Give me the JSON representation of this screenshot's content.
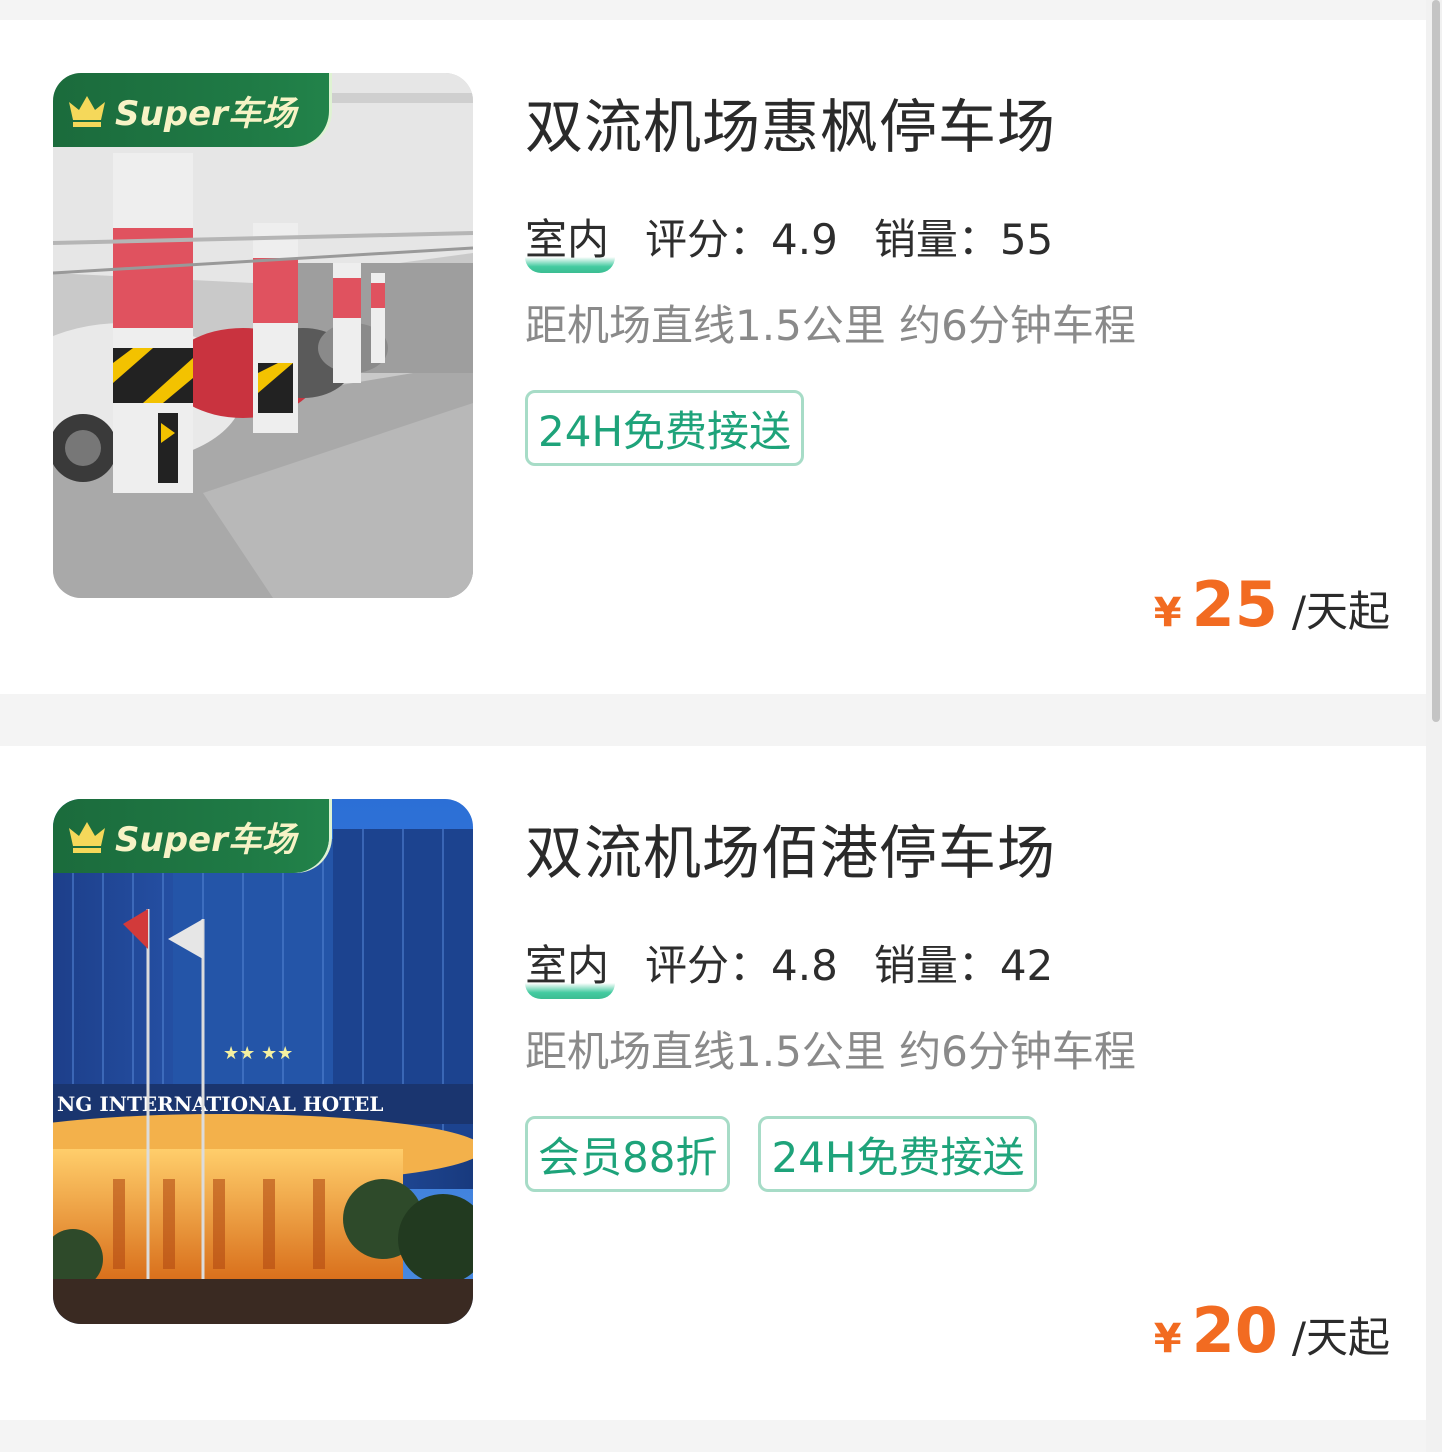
{
  "listings": [
    {
      "badge": "Super车场",
      "name": "双流机场惠枫停车场",
      "type": "室内",
      "rating": "评分：4.9",
      "sales": "销量：55",
      "distance": "距机场直线1.5公里 约6分钟车程",
      "tags": [
        "24H免费接送"
      ],
      "currency": "¥",
      "price": "25",
      "unit": "/天起"
    },
    {
      "badge": "Super车场",
      "name": "双流机场佰港停车场",
      "type": "室内",
      "rating": "评分：4.8",
      "sales": "销量：42",
      "distance": "距机场直线1.5公里 约6分钟车程",
      "tags": [
        "会员88折",
        "24H免费接送"
      ],
      "currency": "¥",
      "price": "20",
      "unit": "/天起"
    }
  ],
  "colors": {
    "accent_green": "#1ea37a",
    "price_orange": "#f26b21",
    "badge_green": "#1f7a45"
  },
  "icons": {
    "badge_icon": "crown-icon"
  }
}
